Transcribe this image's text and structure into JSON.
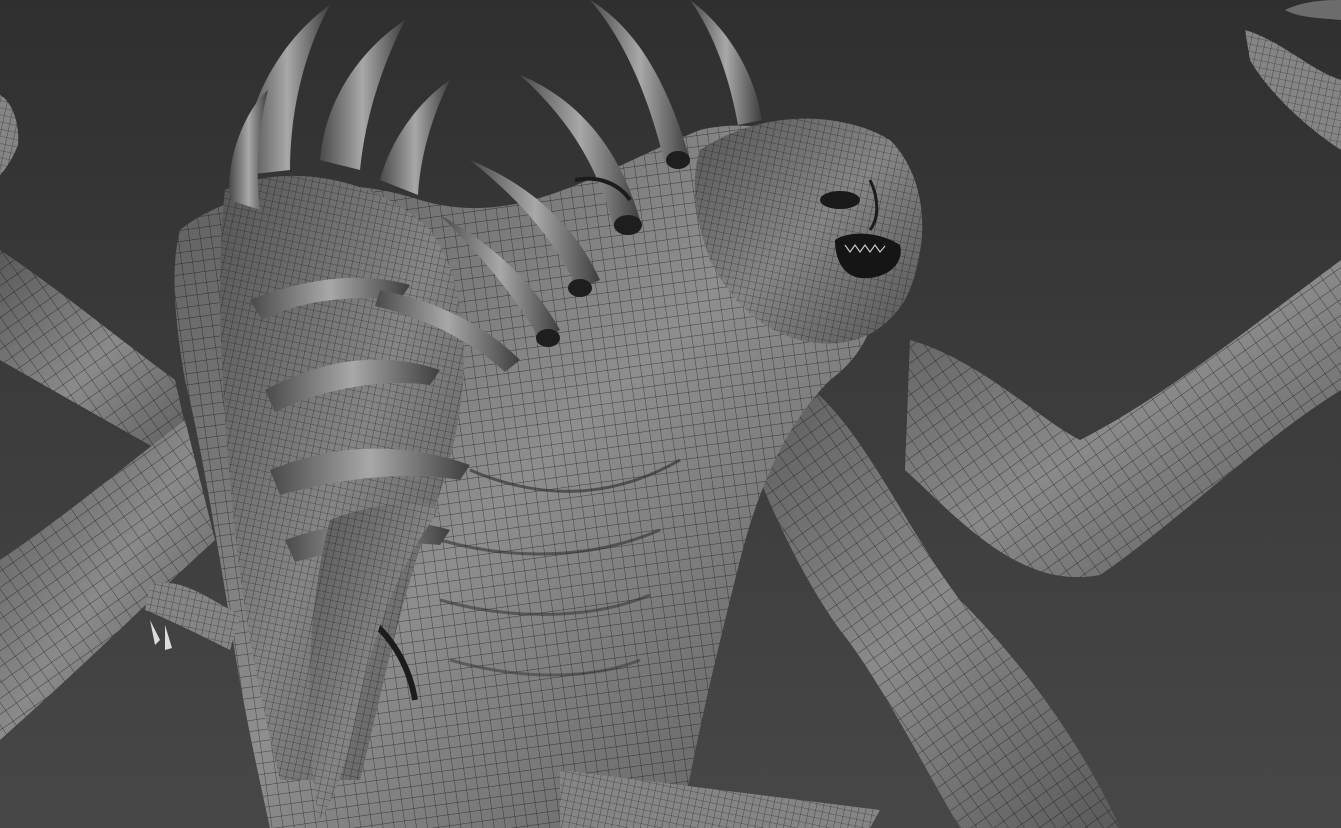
{
  "viewport": {
    "shading_mode": "wireframe-on-shaded",
    "background_color": "#3a3a3a",
    "mesh_fill_color": "#8c8c8c",
    "wire_color": "#1c1c1c"
  },
  "model": {
    "parts": [
      "head",
      "torso",
      "left-arm",
      "right-arm",
      "back-arm",
      "horns",
      "rib-spines",
      "tusk"
    ]
  }
}
